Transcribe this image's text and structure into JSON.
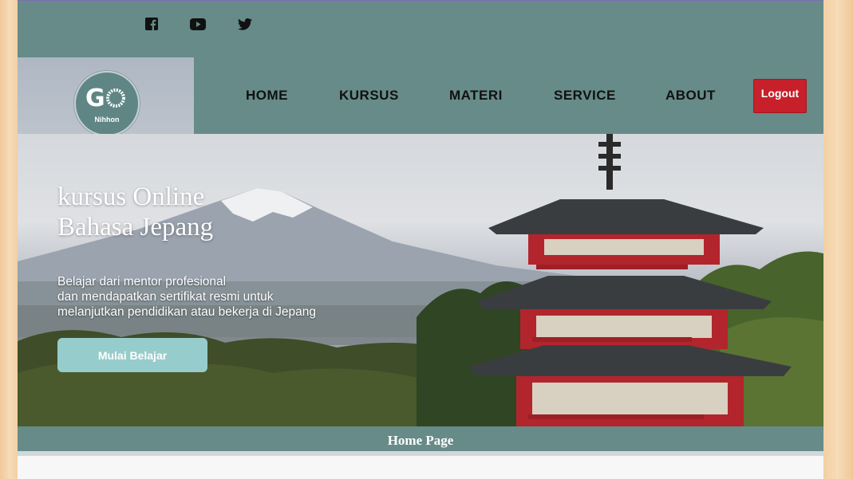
{
  "social": {
    "icons": [
      "facebook-icon",
      "youtube-icon",
      "twitter-icon"
    ]
  },
  "logo": {
    "main": "GO",
    "sub": "Nihhon"
  },
  "nav": {
    "items": [
      "HOME",
      "KURSUS",
      "MATERI",
      "SERVICE",
      "ABOUT"
    ],
    "logout_label": "Logout"
  },
  "hero": {
    "title_line1": "kursus Online",
    "title_line2": "Bahasa Jepang",
    "desc_line1": "Belajar dari mentor profesional",
    "desc_line2": "dan mendapatkan sertifikat resmi untuk",
    "desc_line3": "melanjutkan pendidikan atau bekerja di Jepang",
    "cta_label": "Mulai Belajar"
  },
  "footer": {
    "title": "Home Page"
  },
  "colors": {
    "header_bg": "#668b89",
    "logout_bg": "#c8202a",
    "cta_bg": "#97cccc",
    "page_border": "#f2d0a4"
  }
}
